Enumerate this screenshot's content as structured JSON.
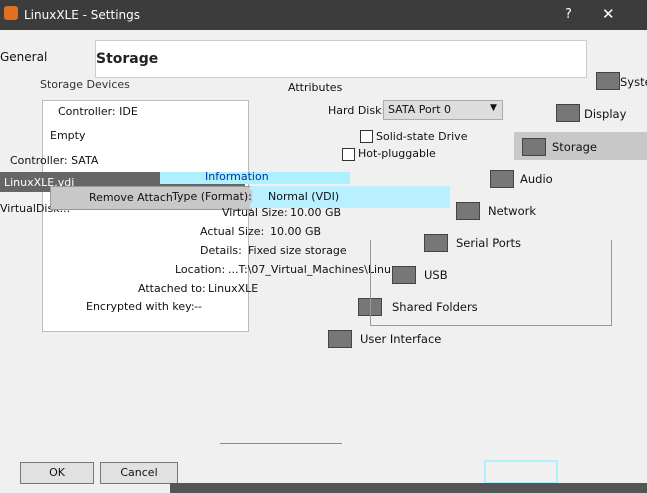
{
  "window": {
    "title": "LinuxXLE - Settings",
    "help": "?",
    "close": "✕"
  },
  "page": {
    "title": "Storage",
    "general_tab": "General"
  },
  "storage": {
    "group_label": "Storage Devices",
    "tree": [
      "Controller: IDE",
      "Empty",
      "Controller: SATA",
      "LinuxXLE.vdi",
      "VirtualDisk..."
    ],
    "context_menu": "Remove Attachment"
  },
  "attributes": {
    "label": "Attributes",
    "hard_disk_label": "Hard Disk:",
    "hard_disk_value": "SATA Port 0",
    "ssd_label": "Solid-state Drive",
    "hotplug_label": "Hot-pluggable"
  },
  "information": {
    "label": "Information",
    "rows": [
      {
        "k": "Type (Format):",
        "v": "Normal (VDI)"
      },
      {
        "k": "Virtual Size:",
        "v": "10.00 GB"
      },
      {
        "k": "Actual Size:",
        "v": "10.00 GB"
      },
      {
        "k": "Details:",
        "v": "Fixed size storage"
      },
      {
        "k": "Location:",
        "v": "...T:\\07_Virtual_Machines\\Linu"
      },
      {
        "k": "Attached to:",
        "v": "LinuxXLE"
      },
      {
        "k": "Encrypted with key:",
        "v": "--"
      }
    ]
  },
  "nav": [
    "System",
    "Display",
    "Storage",
    "Audio",
    "Network",
    "Serial Ports",
    "USB",
    "Shared Folders",
    "User Interface"
  ],
  "buttons": {
    "ok": "OK",
    "cancel": "Cancel"
  }
}
